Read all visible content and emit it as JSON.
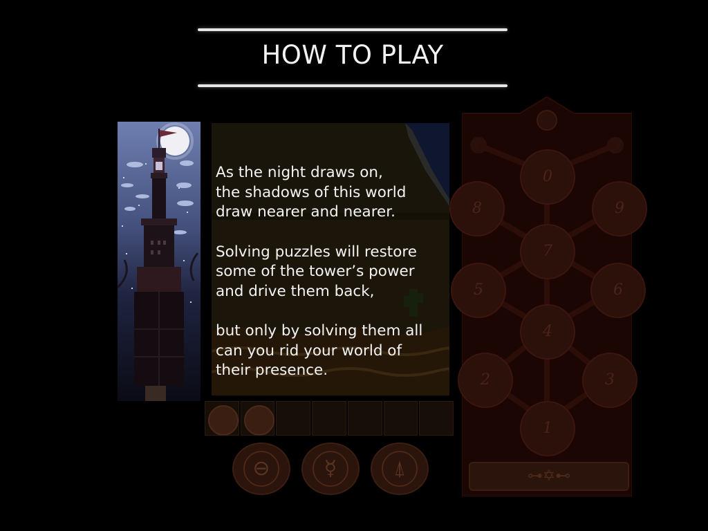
{
  "screen": {
    "title": "HOW TO PLAY",
    "paragraphs": [
      [
        "As the night draws on,",
        "the shadows of this world",
        "draw nearer and nearer."
      ],
      [
        "Solving puzzles will restore",
        "some of the tower’s power",
        "and drive them back,"
      ],
      [
        "but only by solving them all",
        "can you rid your world of",
        "their presence."
      ]
    ]
  },
  "inventory": {
    "slots": [
      {
        "icon": "jar-icon"
      },
      {
        "icon": "creature-icon"
      },
      {
        "icon": "empty"
      },
      {
        "icon": "empty"
      },
      {
        "icon": "empty"
      },
      {
        "icon": "empty"
      },
      {
        "icon": "empty"
      }
    ]
  },
  "runes": [
    {
      "icon": "circle-bar-icon",
      "glyph": "⊖"
    },
    {
      "icon": "mercury-icon",
      "glyph": "☿"
    },
    {
      "icon": "up-arrow-triangle-icon",
      "glyph": "⍋"
    }
  ],
  "board": {
    "nodes": [
      {
        "label": "0"
      },
      {
        "label": "8"
      },
      {
        "label": "9"
      },
      {
        "label": "7"
      },
      {
        "label": "5"
      },
      {
        "label": "6"
      },
      {
        "label": "4"
      },
      {
        "label": "2"
      },
      {
        "label": "3"
      },
      {
        "label": "1"
      }
    ],
    "slider_glyph": "⊶✡⊷"
  },
  "colors": {
    "background": "#000000",
    "title_text": "#f2f2f2",
    "rule": "#e6e6e6",
    "board_dim_red": "#2c100a"
  }
}
